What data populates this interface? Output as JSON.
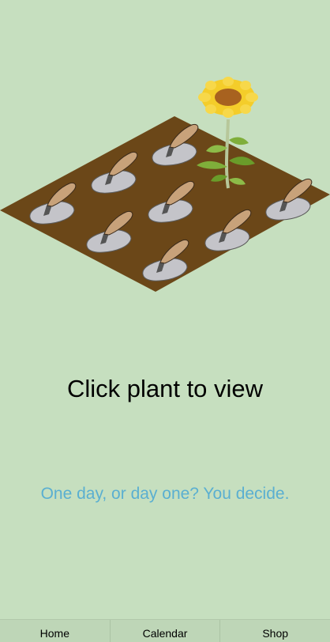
{
  "garden": {
    "prompt": "Click plant to view",
    "plots": [
      {
        "id": "plot-1",
        "state": "empty",
        "icon": "trowel-icon"
      },
      {
        "id": "plot-2",
        "state": "empty",
        "icon": "trowel-icon"
      },
      {
        "id": "plot-3",
        "state": "planted",
        "plant": "sunflower",
        "icon": "sunflower-icon"
      },
      {
        "id": "plot-4",
        "state": "empty",
        "icon": "trowel-icon"
      },
      {
        "id": "plot-5",
        "state": "empty",
        "icon": "trowel-icon"
      },
      {
        "id": "plot-6",
        "state": "empty",
        "icon": "trowel-icon"
      },
      {
        "id": "plot-7",
        "state": "empty",
        "icon": "trowel-icon"
      },
      {
        "id": "plot-8",
        "state": "empty",
        "icon": "trowel-icon"
      },
      {
        "id": "plot-9",
        "state": "empty",
        "icon": "trowel-icon"
      }
    ]
  },
  "tagline": "One day, or day one? You decide.",
  "tabs": [
    {
      "label": "Home"
    },
    {
      "label": "Calendar"
    },
    {
      "label": "Shop"
    }
  ],
  "colors": {
    "background": "#c6dfbf",
    "soil": "#6b4718",
    "tagline": "#5aafd1",
    "tab_bar": "#bed6b7"
  }
}
